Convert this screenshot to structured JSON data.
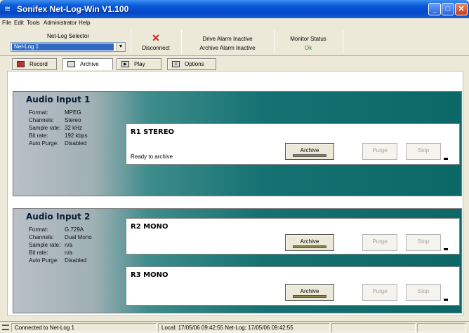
{
  "window": {
    "title": "Sonifex Net-Log-Win V1.100"
  },
  "menu": [
    "File",
    "Edit",
    "Tools",
    "Administrator",
    "Help"
  ],
  "toolbar": {
    "selector_label": "Net-Log Selector",
    "selector_value": "Net-Log 1",
    "disconnect_label": "Disconnect",
    "drive_alarm": "Drive Alarm Inactive",
    "archive_alarm": "Archive Alarm Inactive",
    "monitor_label": "Monitor Status",
    "monitor_value": "Ok",
    "monitor_color": "#2e8b2e"
  },
  "tabs": [
    {
      "label": "Record",
      "icon": "record-icon"
    },
    {
      "label": "Archive",
      "icon": "archive-icon",
      "active": true
    },
    {
      "label": "Play",
      "icon": "play-icon"
    },
    {
      "label": "Options",
      "icon": "options-icon"
    }
  ],
  "field_labels": {
    "format": "Format:",
    "channels": "Channels:",
    "sample_rate": "Sample rate:",
    "bit_rate": "Bit rate:",
    "auto_purge": "Auto Purge:"
  },
  "inputs": [
    {
      "title": "Audio Input 1",
      "format": "MPEG",
      "channels": "Stereo",
      "sample_rate": "32 kHz",
      "bit_rate": "192 kbps",
      "auto_purge": "Disabled",
      "recorders": [
        {
          "name": "R1 STEREO",
          "status": "Ready to archive"
        }
      ]
    },
    {
      "title": "Audio Input 2",
      "format": "G.729A",
      "channels": "Dual Mono",
      "sample_rate": "n/a",
      "bit_rate": "n/a",
      "auto_purge": "Disabled",
      "recorders": [
        {
          "name": "R2 MONO",
          "status": ""
        },
        {
          "name": "R3 MONO",
          "status": ""
        }
      ]
    }
  ],
  "buttons": {
    "archive": "Archive",
    "purge": "Purge",
    "stop": "Stop"
  },
  "statusbar": {
    "connection": "Connected to Net-Log 1",
    "times": "Local: 17/05/06 09:42:55    Net-Log: 17/05/06 09:42:55"
  }
}
